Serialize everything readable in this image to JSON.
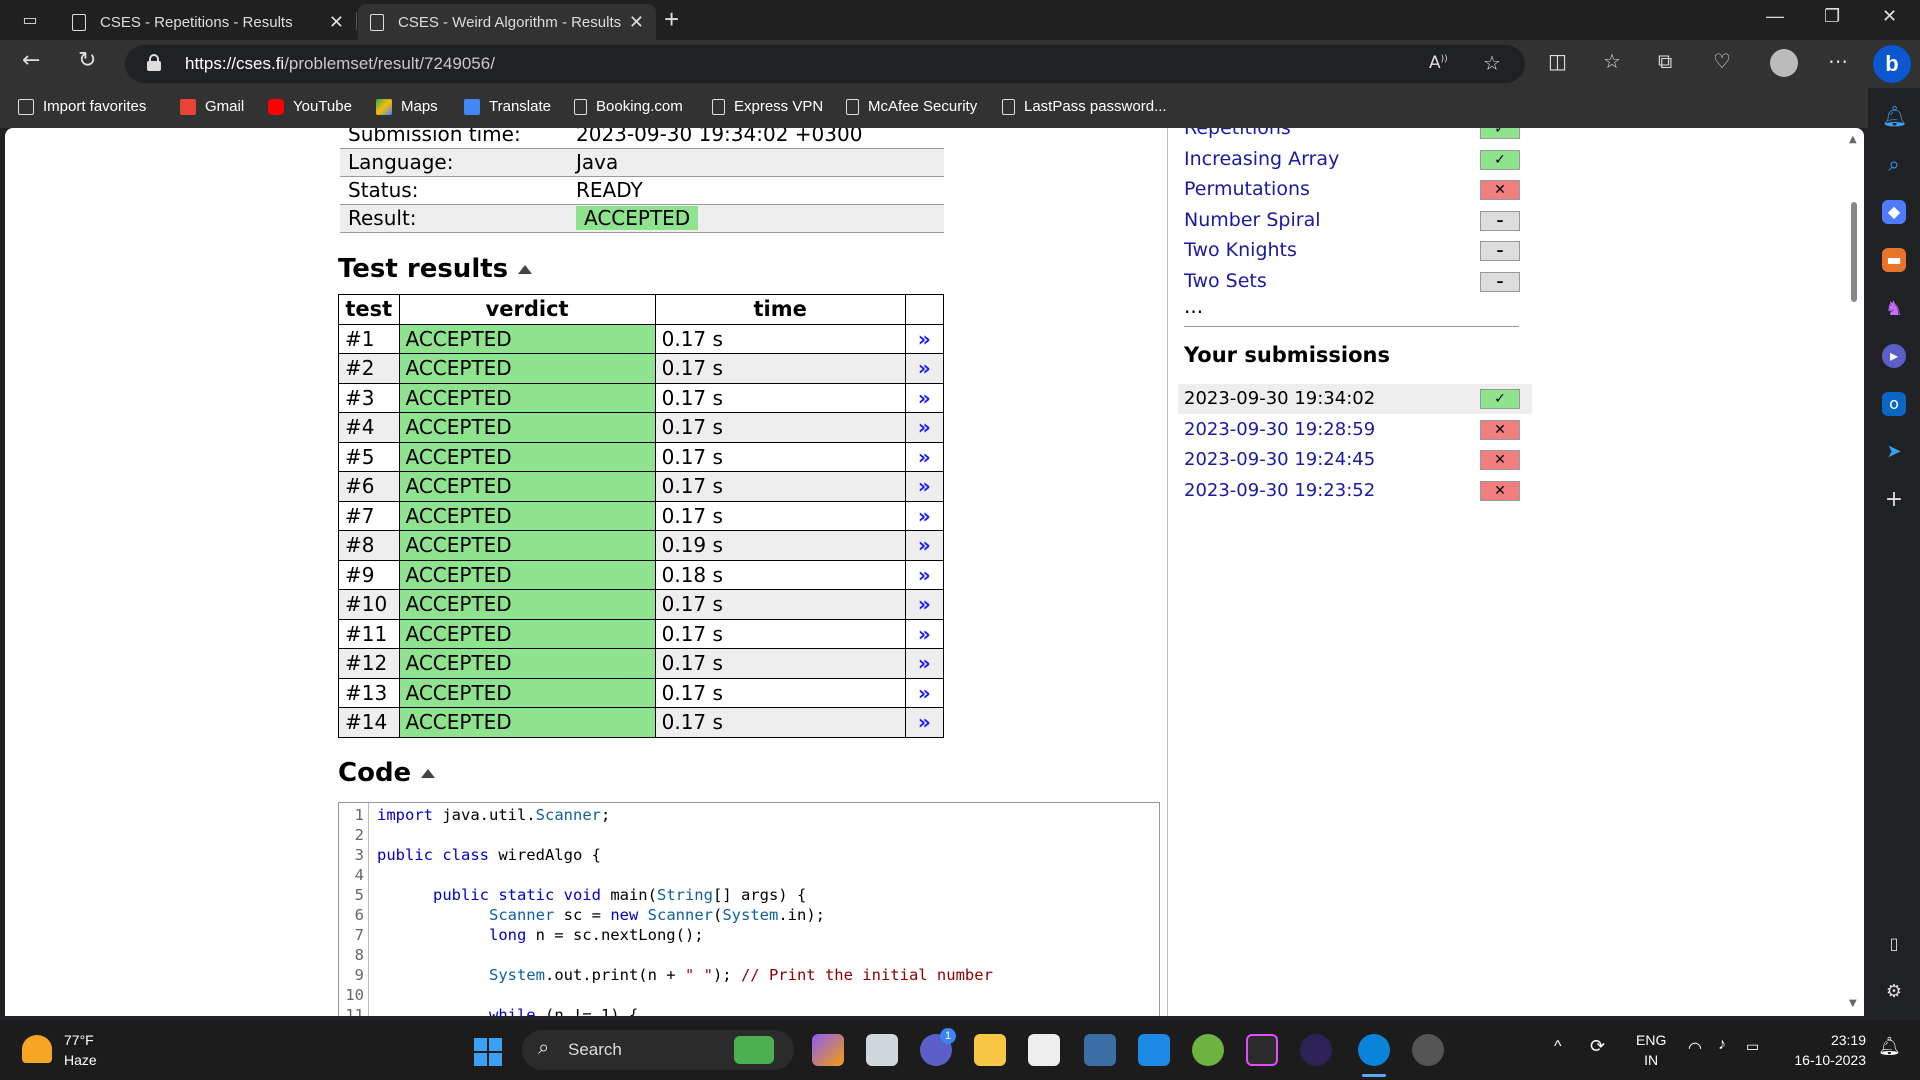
{
  "browser": {
    "tabs": [
      {
        "title": "CSES - Repetitions - Results",
        "active": false
      },
      {
        "title": "CSES - Weird Algorithm - Results",
        "active": true
      }
    ],
    "url_host": "https://cses.fi",
    "url_path": "/problemset/result/7249056/",
    "favorites": [
      {
        "label": "Import favorites",
        "icon": "import-icon"
      },
      {
        "label": "Gmail",
        "icon": "gmail-icon"
      },
      {
        "label": "YouTube",
        "icon": "youtube-icon"
      },
      {
        "label": "Maps",
        "icon": "maps-icon"
      },
      {
        "label": "Translate",
        "icon": "translate-icon"
      },
      {
        "label": "Booking.com",
        "icon": "page-icon"
      },
      {
        "label": "Express VPN",
        "icon": "page-icon"
      },
      {
        "label": "McAfee Security",
        "icon": "page-icon"
      },
      {
        "label": "LastPass password...",
        "icon": "page-icon"
      }
    ]
  },
  "submission": {
    "rows": [
      {
        "key": "Submission time:",
        "value": "2023-09-30 19:34:02 +0300"
      },
      {
        "key": "Language:",
        "value": "Java"
      },
      {
        "key": "Status:",
        "value": "READY"
      },
      {
        "key": "Result:",
        "value": "ACCEPTED"
      }
    ]
  },
  "tests": {
    "heading": "Test results",
    "headers": [
      "test",
      "verdict",
      "time"
    ],
    "link_glyph": "»",
    "rows": [
      {
        "test": "#1",
        "verdict": "ACCEPTED",
        "time": "0.17 s"
      },
      {
        "test": "#2",
        "verdict": "ACCEPTED",
        "time": "0.17 s"
      },
      {
        "test": "#3",
        "verdict": "ACCEPTED",
        "time": "0.17 s"
      },
      {
        "test": "#4",
        "verdict": "ACCEPTED",
        "time": "0.17 s"
      },
      {
        "test": "#5",
        "verdict": "ACCEPTED",
        "time": "0.17 s"
      },
      {
        "test": "#6",
        "verdict": "ACCEPTED",
        "time": "0.17 s"
      },
      {
        "test": "#7",
        "verdict": "ACCEPTED",
        "time": "0.17 s"
      },
      {
        "test": "#8",
        "verdict": "ACCEPTED",
        "time": "0.19 s"
      },
      {
        "test": "#9",
        "verdict": "ACCEPTED",
        "time": "0.18 s"
      },
      {
        "test": "#10",
        "verdict": "ACCEPTED",
        "time": "0.17 s"
      },
      {
        "test": "#11",
        "verdict": "ACCEPTED",
        "time": "0.17 s"
      },
      {
        "test": "#12",
        "verdict": "ACCEPTED",
        "time": "0.17 s"
      },
      {
        "test": "#13",
        "verdict": "ACCEPTED",
        "time": "0.17 s"
      },
      {
        "test": "#14",
        "verdict": "ACCEPTED",
        "time": "0.17 s"
      }
    ]
  },
  "code": {
    "heading": "Code",
    "line_numbers": [
      "1",
      "2",
      "3",
      "4",
      "5",
      "6",
      "7",
      "8",
      "9",
      "10",
      "11"
    ],
    "lines": [
      [
        {
          "t": "import",
          "c": "kw"
        },
        {
          "t": " java.util.",
          "c": ""
        },
        {
          "t": "Scanner",
          "c": "ty"
        },
        {
          "t": ";",
          "c": ""
        }
      ],
      [],
      [
        {
          "t": "public class",
          "c": "kw"
        },
        {
          "t": " wiredAlgo {",
          "c": ""
        }
      ],
      [],
      [
        {
          "t": "      ",
          "c": ""
        },
        {
          "t": "public static void",
          "c": "kw"
        },
        {
          "t": " main(",
          "c": ""
        },
        {
          "t": "String",
          "c": "ty"
        },
        {
          "t": "[] args) {",
          "c": ""
        }
      ],
      [
        {
          "t": "            ",
          "c": ""
        },
        {
          "t": "Scanner",
          "c": "ty"
        },
        {
          "t": " sc = ",
          "c": ""
        },
        {
          "t": "new",
          "c": "kw"
        },
        {
          "t": " ",
          "c": ""
        },
        {
          "t": "Scanner",
          "c": "ty"
        },
        {
          "t": "(",
          "c": ""
        },
        {
          "t": "System",
          "c": "ty"
        },
        {
          "t": ".in);",
          "c": ""
        }
      ],
      [
        {
          "t": "            ",
          "c": ""
        },
        {
          "t": "long",
          "c": "kw"
        },
        {
          "t": " n = sc.nextLong();",
          "c": ""
        }
      ],
      [],
      [
        {
          "t": "            ",
          "c": ""
        },
        {
          "t": "System",
          "c": "ty"
        },
        {
          "t": ".out.print(n + ",
          "c": ""
        },
        {
          "t": "\" \"",
          "c": "st"
        },
        {
          "t": "); ",
          "c": ""
        },
        {
          "t": "// Print the initial number",
          "c": "cm"
        }
      ],
      [],
      [
        {
          "t": "            ",
          "c": ""
        },
        {
          "t": "while",
          "c": "kw"
        },
        {
          "t": " (n != 1) {",
          "c": ""
        }
      ]
    ]
  },
  "task_nav": {
    "tasks": [
      {
        "name": "Repetitions",
        "status": "ok",
        "glyph": "✓"
      },
      {
        "name": "Increasing Array",
        "status": "ok",
        "glyph": "✓"
      },
      {
        "name": "Permutations",
        "status": "fail",
        "glyph": "✕"
      },
      {
        "name": "Number Spiral",
        "status": "none",
        "glyph": "–"
      },
      {
        "name": "Two Knights",
        "status": "none",
        "glyph": "–"
      },
      {
        "name": "Two Sets",
        "status": "none",
        "glyph": "–"
      }
    ],
    "more": "...",
    "your_submissions_title": "Your submissions",
    "submissions": [
      {
        "time": "2023-09-30 19:34:02",
        "status": "ok",
        "glyph": "✓",
        "current": true
      },
      {
        "time": "2023-09-30 19:28:59",
        "status": "fail",
        "glyph": "✕",
        "current": false
      },
      {
        "time": "2023-09-30 19:24:45",
        "status": "fail",
        "glyph": "✕",
        "current": false
      },
      {
        "time": "2023-09-30 19:23:52",
        "status": "fail",
        "glyph": "✕",
        "current": false
      }
    ]
  },
  "taskbar": {
    "weather_temp": "77°F",
    "weather_desc": "Haze",
    "search_label": "Search",
    "lang_line1": "ENG",
    "lang_line2": "IN",
    "clock_time": "23:19",
    "clock_date": "16-10-2023",
    "notification_count": "1"
  },
  "colors": {
    "accepted": "#8fe38f",
    "failed": "#f27f7f",
    "neutral": "#dddddd",
    "link": "#1a1aa0"
  }
}
